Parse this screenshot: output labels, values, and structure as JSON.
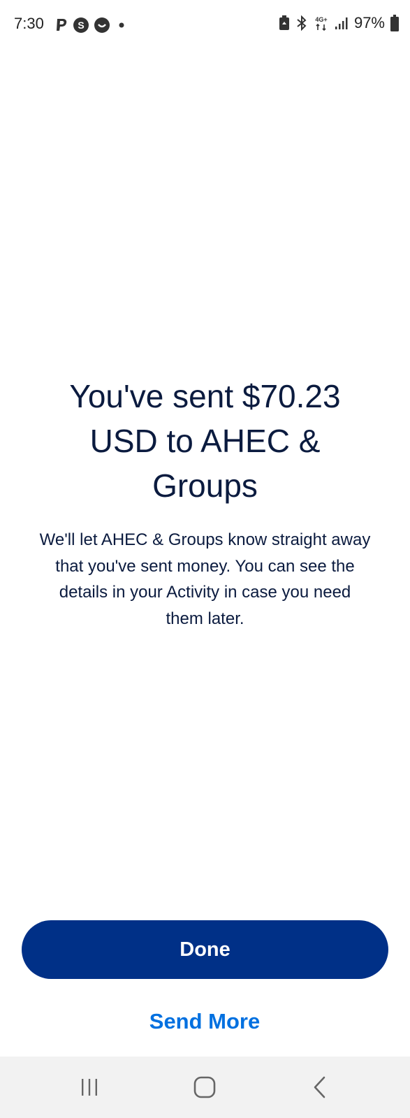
{
  "status_bar": {
    "time": "7:30",
    "battery": "97%",
    "notification_icons": [
      "paypal-icon",
      "skype-icon",
      "chat-icon",
      "dot-icon"
    ],
    "system_icons": [
      "battery-saver-icon",
      "bluetooth-icon",
      "4g-data-icon",
      "signal-icon",
      "battery-icon"
    ],
    "network_label": "4G+"
  },
  "confirmation": {
    "headline": "You've sent $70.23 USD to AHEC & Groups",
    "message": "We'll let AHEC & Groups know straight away that you've sent money. You can see the details in your Activity in case you need them later."
  },
  "actions": {
    "done_label": "Done",
    "send_more_label": "Send More"
  },
  "colors": {
    "primary_button": "#003087",
    "link": "#0070e0",
    "text": "#0b1b3f",
    "nav_bar": "#f2f2f2"
  },
  "nav_bar": {
    "buttons": [
      "recent-apps-icon",
      "home-icon",
      "back-icon"
    ]
  }
}
